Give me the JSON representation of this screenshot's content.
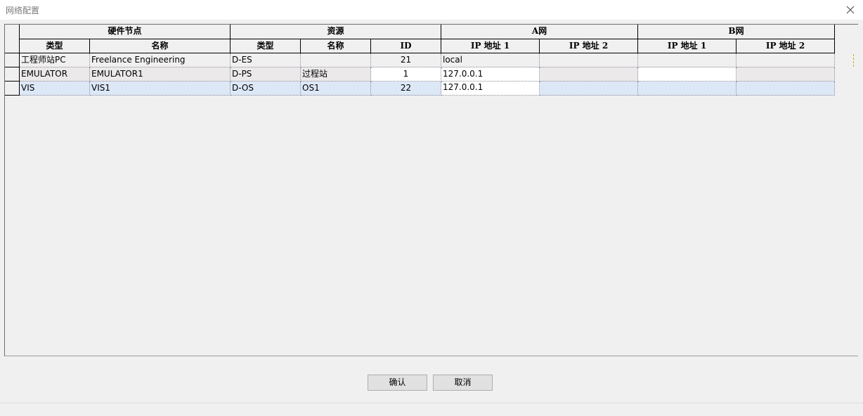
{
  "window": {
    "title": "网络配置",
    "close_icon": "close-icon"
  },
  "table": {
    "group_headers": {
      "hardware_node": "硬件节点",
      "resource": "资源",
      "net_a": "A网",
      "net_b": "B网"
    },
    "column_headers": {
      "hw_type": "类型",
      "hw_name": "名称",
      "res_type": "类型",
      "res_name": "名称",
      "id": "ID",
      "a_ip1": "IP 地址 1",
      "a_ip2": "IP 地址 2",
      "b_ip1": "IP 地址 1",
      "b_ip2": "IP 地址 2"
    },
    "rows": [
      {
        "hw_type": "工程师站PC",
        "hw_name": "Freelance Engineering",
        "res_type": "D-ES",
        "res_name": "",
        "id": "21",
        "a_ip1": "local",
        "a_ip2": "",
        "b_ip1": "",
        "b_ip2": ""
      },
      {
        "hw_type": "EMULATOR",
        "hw_name": "EMULATOR1",
        "res_type": "D-PS",
        "res_name": "过程站",
        "id": "1",
        "a_ip1": "127.0.0.1",
        "a_ip2": "",
        "b_ip1": "",
        "b_ip2": ""
      },
      {
        "hw_type": "VIS",
        "hw_name": "VIS1",
        "res_type": "D-OS",
        "res_name": "OS1",
        "id": "22",
        "a_ip1": "127.0.0.1",
        "a_ip2": "",
        "b_ip1": "",
        "b_ip2": ""
      }
    ]
  },
  "buttons": {
    "confirm": "确认",
    "cancel": "取消"
  }
}
